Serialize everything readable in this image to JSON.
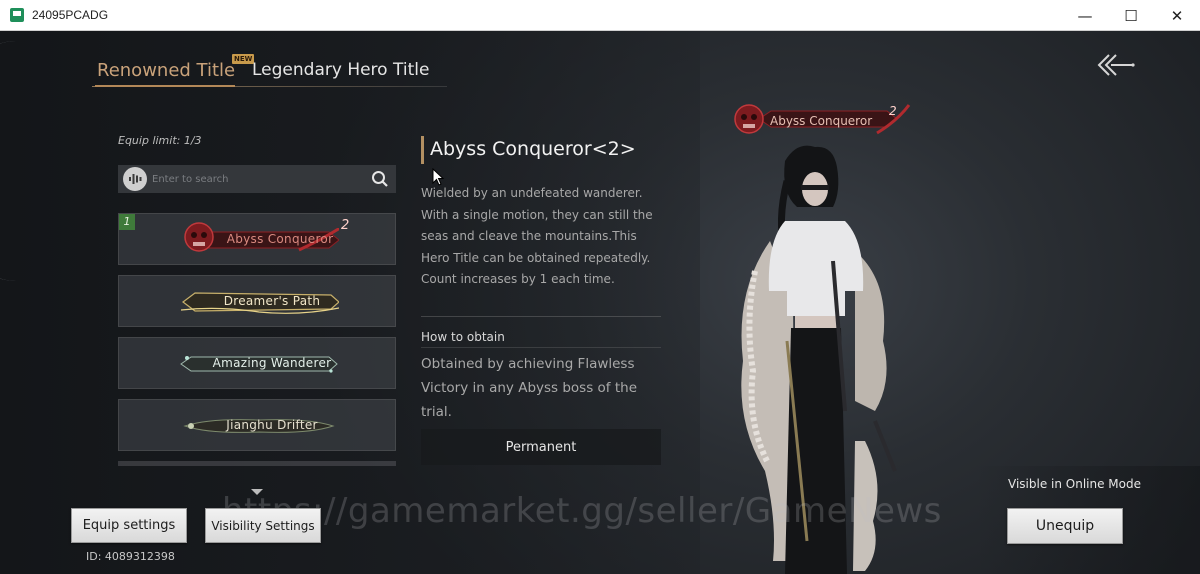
{
  "window": {
    "title": "24095PCADG",
    "minimize_glyph": "—",
    "maximize_glyph": "☐",
    "close_glyph": "✕"
  },
  "tabs": {
    "active": "Renowned Title",
    "new_badge": "NEW",
    "inactive": "Legendary Hero Title"
  },
  "list": {
    "equip_limit": "Equip limit: 1/3",
    "search_placeholder": "Enter to search",
    "items": [
      {
        "badge": "1",
        "label": "Abyss Conqueror",
        "count": "2",
        "color": "#d98a80"
      },
      {
        "label": "Dreamer's Path",
        "color": "#f1e6c8"
      },
      {
        "label": "Amazing Wanderer",
        "color": "#e4f0ea"
      },
      {
        "label": "Jianghu Drifter",
        "color": "#e6e0cf"
      }
    ]
  },
  "detail": {
    "title": "Abyss Conqueror<2>",
    "description": "Wielded by an undefeated wanderer. With a single motion, they can still the seas and cleave the mountains.This Hero Title can be obtained repeatedly. Count increases by 1 each time.",
    "how_to_obtain_label": "How to obtain",
    "how_to_obtain_text": "Obtained by achieving Flawless Victory in any Abyss boss of the trial.",
    "duration": "Permanent"
  },
  "character": {
    "title_plate": "Abyss Conqueror",
    "title_count": "2"
  },
  "bottom": {
    "equip_settings": "Equip settings",
    "visibility_settings": "Visibility Settings",
    "id_text": "ID: 4089312398",
    "visible_mode": "Visible in Online Mode",
    "unequip": "Unequip",
    "watermark": "https://gamemarket.gg/seller/GameNews"
  },
  "colors": {
    "accent_gold": "#c9a27a",
    "title_red": "#8e1f24"
  }
}
